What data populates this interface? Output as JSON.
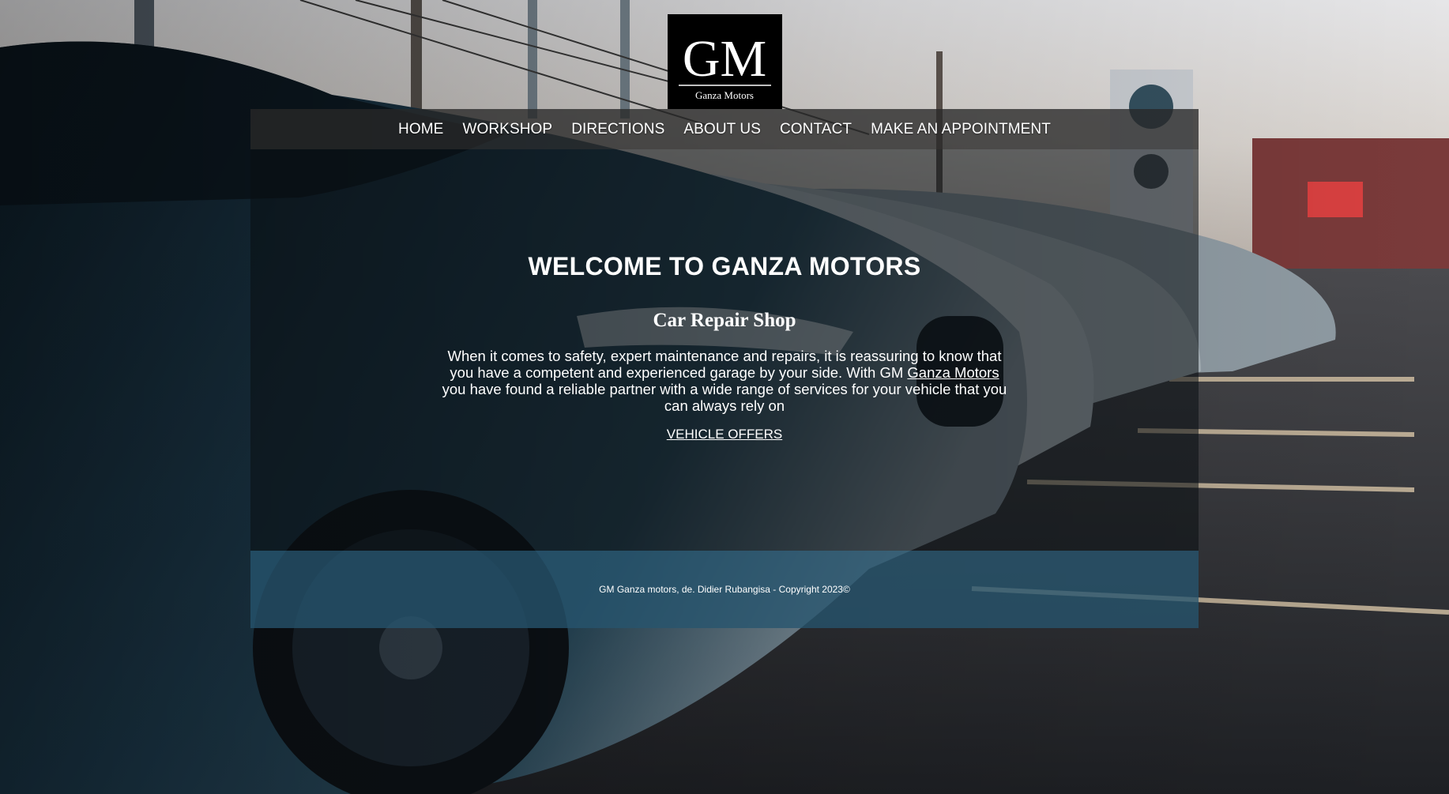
{
  "brand": {
    "monogram": "GM",
    "name": "Ganza Motors"
  },
  "nav": {
    "items": [
      {
        "label": "HOME"
      },
      {
        "label": "WORKSHOP"
      },
      {
        "label": "DIRECTIONS"
      },
      {
        "label": "ABOUT US"
      },
      {
        "label": "CONTACT"
      },
      {
        "label": "MAKE AN APPOINTMENT"
      }
    ]
  },
  "hero": {
    "title": "WELCOME TO GANZA MOTORS",
    "subtitle": "Car Repair Shop",
    "text_before": "When it comes to safety, expert maintenance and repairs, it is reassuring to know that you have a competent and experienced garage by your side. With GM ",
    "link_text": "Ganza Motors",
    "text_after": " you have found a reliable partner with a wide range of services for your vehicle that you can always rely on",
    "offers_label": "VEHICLE OFFERS"
  },
  "footer": {
    "copyright": "GM Ganza motors, de. Didier Rubangisa - Copyright 2023©"
  },
  "colors": {
    "navbar": "#282828",
    "footer": "#26556e",
    "logo_bg": "#000000"
  }
}
